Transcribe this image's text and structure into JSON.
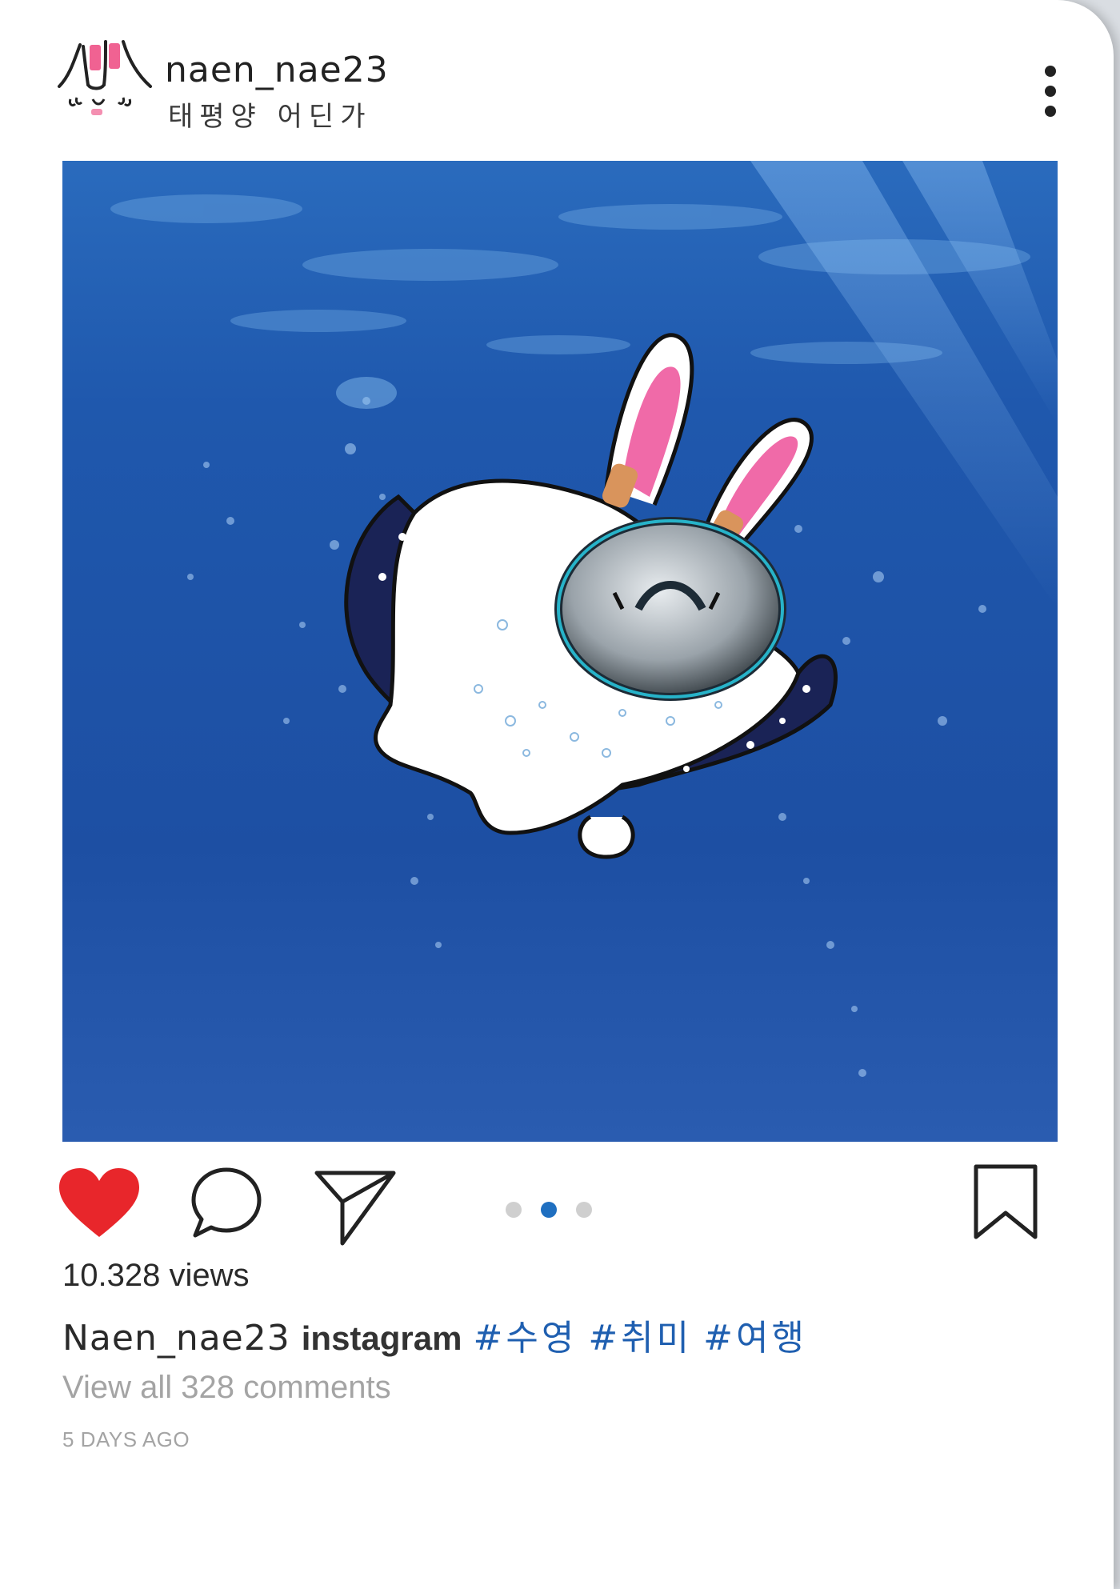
{
  "post": {
    "username": "naen_nae23",
    "location": "태평양 어딘가",
    "views": "10.328 views",
    "caption_user": "Naen_nae23",
    "caption_text": "instagram",
    "hashtags": [
      "#수영",
      "#취미",
      "#여행"
    ],
    "comments_link": "View all 328 comments",
    "timestamp": "5 DAYS AGO"
  },
  "icons": {
    "avatar": "bunny-avatar-icon",
    "more": "more-vertical-icon",
    "like": "heart-icon",
    "comment": "comment-icon",
    "share": "send-icon",
    "save": "bookmark-icon"
  },
  "carousel": {
    "count": 3,
    "active_index": 1
  },
  "colors": {
    "like": "#e8262b",
    "hashtag": "#1f5fb0",
    "dot_active": "#1f6fc0",
    "dot_inactive": "#cfcfcf",
    "muted_text": "#a4a4a4",
    "water": "#1f56a8"
  }
}
